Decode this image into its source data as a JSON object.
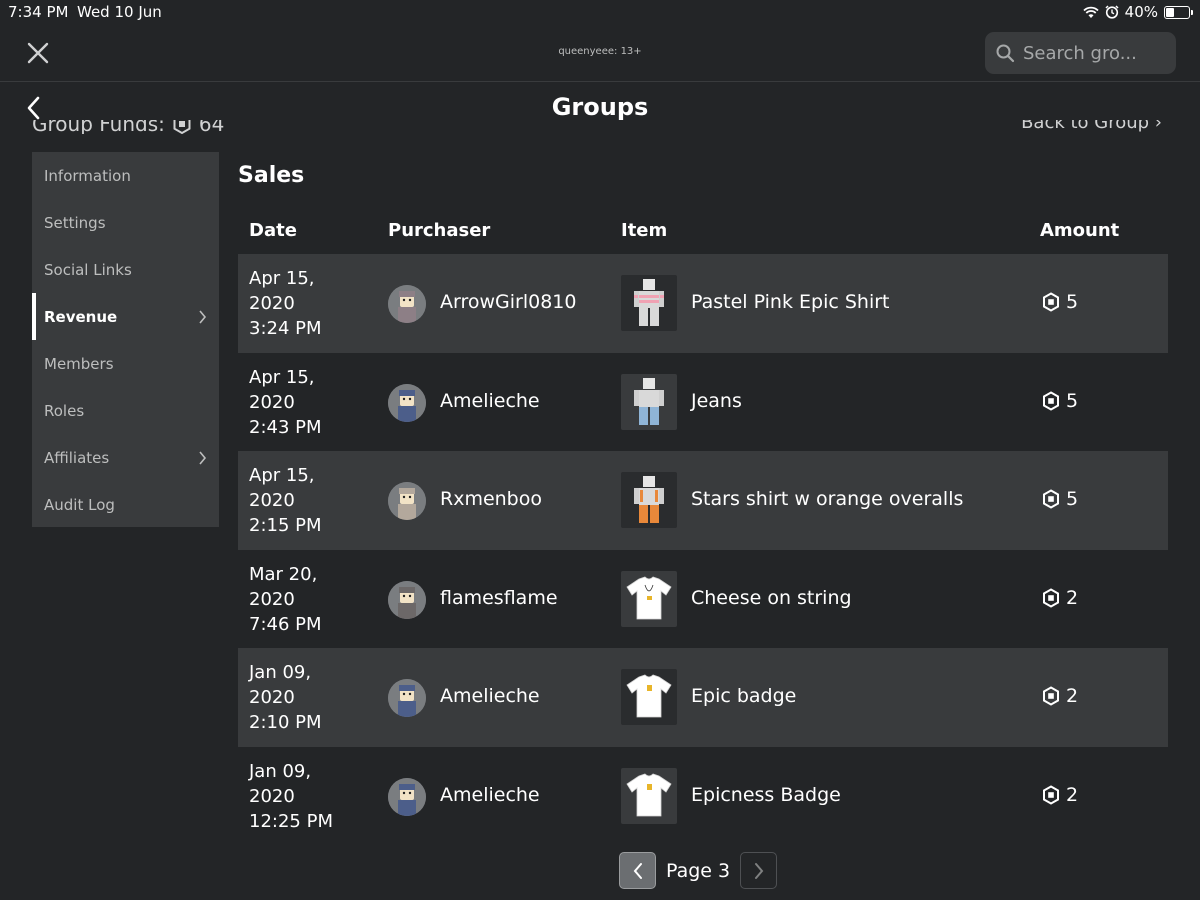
{
  "status_bar": {
    "time": "7:34 PM",
    "date": "Wed 10 Jun",
    "battery": "40%",
    "battery_level": 0.4
  },
  "top_bar": {
    "account_label": "queenyeee: 13+",
    "search_placeholder": "Search gro..."
  },
  "header": {
    "title": "Groups",
    "group_funds_label": "Group Funds:",
    "group_funds_value": "64",
    "back_to_group": "Back to Group ›"
  },
  "sidebar": {
    "items": [
      {
        "label": "Information",
        "active": false,
        "chevron": false
      },
      {
        "label": "Settings",
        "active": false,
        "chevron": false
      },
      {
        "label": "Social Links",
        "active": false,
        "chevron": false
      },
      {
        "label": "Revenue",
        "active": true,
        "chevron": true
      },
      {
        "label": "Members",
        "active": false,
        "chevron": false
      },
      {
        "label": "Roles",
        "active": false,
        "chevron": false
      },
      {
        "label": "Affiliates",
        "active": false,
        "chevron": true
      },
      {
        "label": "Audit Log",
        "active": false,
        "chevron": false
      }
    ]
  },
  "sales": {
    "title": "Sales",
    "columns": {
      "date": "Date",
      "purchaser": "Purchaser",
      "item": "Item",
      "amount": "Amount"
    },
    "rows": [
      {
        "date": "Apr 15,\n2020\n3:24 PM",
        "purchaser": "ArrowGirl0810",
        "item": "Pastel Pink Epic Shirt",
        "amount": "5"
      },
      {
        "date": "Apr 15,\n2020\n2:43 PM",
        "purchaser": "Amelieche",
        "item": "Jeans",
        "amount": "5"
      },
      {
        "date": "Apr 15,\n2020\n2:15 PM",
        "purchaser": "Rxmenboo",
        "item": "Stars shirt w orange overalls",
        "amount": "5"
      },
      {
        "date": "Mar 20,\n2020\n7:46 PM",
        "purchaser": "flamesflame",
        "item": "Cheese on string",
        "amount": "2"
      },
      {
        "date": "Jan 09,\n2020\n2:10 PM",
        "purchaser": "Amelieche",
        "item": "Epic badge",
        "amount": "2"
      },
      {
        "date": "Jan 09,\n2020\n12:25 PM",
        "purchaser": "Amelieche",
        "item": "Epicness Badge",
        "amount": "2"
      }
    ]
  },
  "pagination": {
    "label": "Page 3"
  },
  "colors": {
    "background": "#232527",
    "panel": "#393b3d",
    "text": "#ffffff",
    "muted": "#bdbebe"
  }
}
